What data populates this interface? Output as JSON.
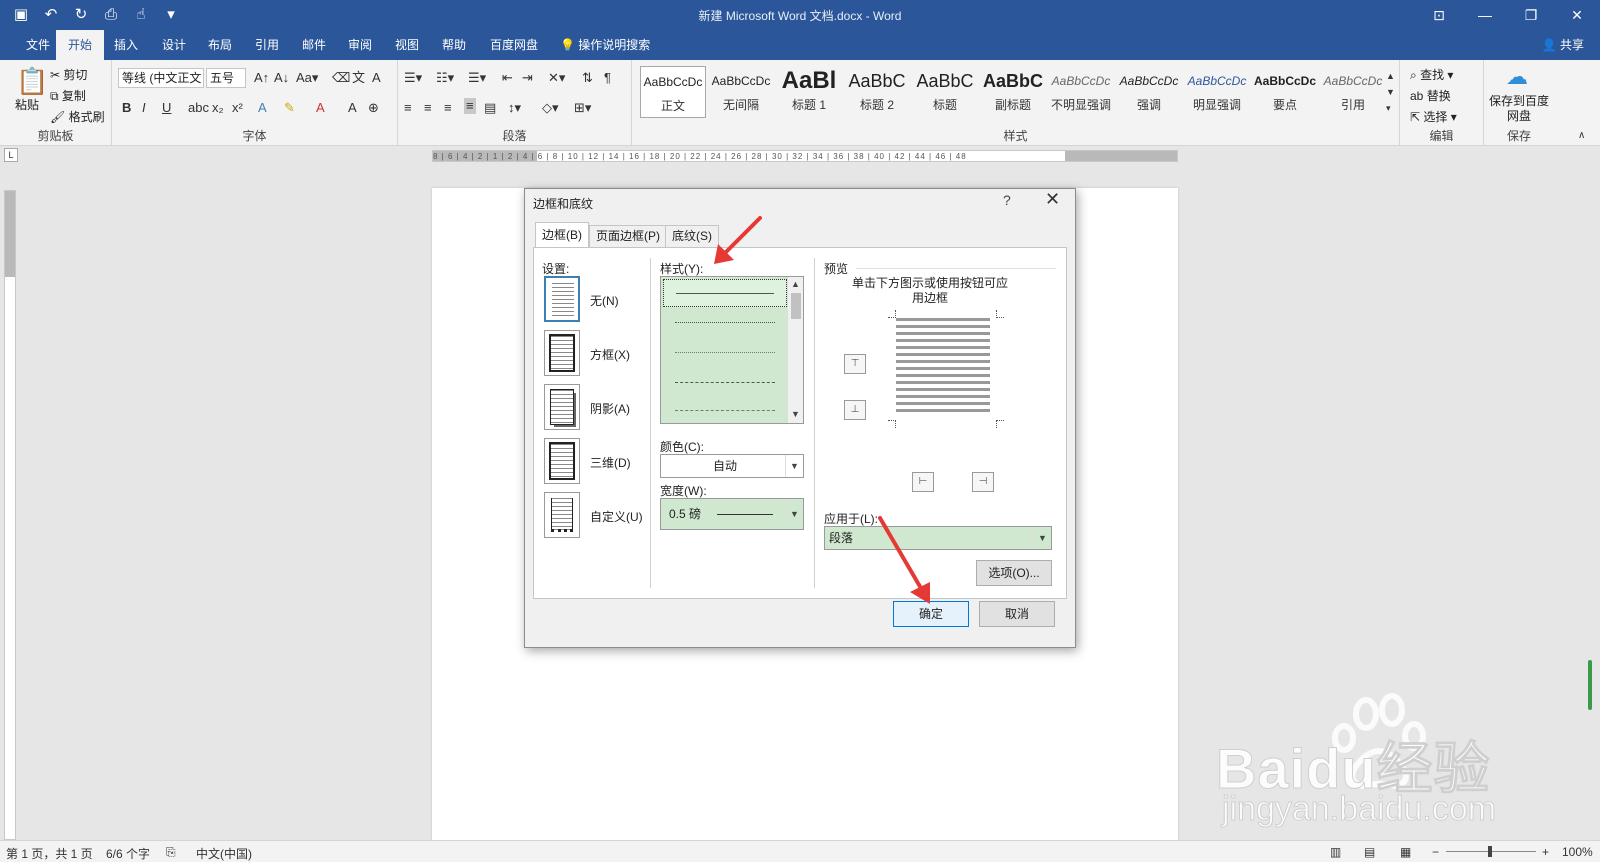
{
  "titlebar": {
    "title": "新建 Microsoft Word 文档.docx  -  Word",
    "qat_icons": [
      "save-icon",
      "undo-icon",
      "redo-icon",
      "print-preview-icon",
      "touch-mode-icon",
      "customize-qat-icon"
    ]
  },
  "ribbon_tabs": [
    "文件",
    "开始",
    "插入",
    "设计",
    "布局",
    "引用",
    "邮件",
    "审阅",
    "视图",
    "帮助",
    "百度网盘"
  ],
  "active_tab": "开始",
  "tell_me": "操作说明搜索",
  "share": "共享",
  "clipboard": {
    "paste": "粘贴",
    "cut": "剪切",
    "copy": "复制",
    "format_painter": "格式刷",
    "label": "剪贴板"
  },
  "font": {
    "name": "等线 (中文正文",
    "size": "五号",
    "label": "字体"
  },
  "paragraph": {
    "label": "段落"
  },
  "styles": {
    "label": "样式",
    "items": [
      {
        "preview": "AaBbCcDc",
        "name": "正文"
      },
      {
        "preview": "AaBbCcDc",
        "name": "无间隔"
      },
      {
        "preview": "AaBl",
        "name": "标题 1"
      },
      {
        "preview": "AaBbC",
        "name": "标题 2"
      },
      {
        "preview": "AaBbC",
        "name": "标题"
      },
      {
        "preview": "AaBbC",
        "name": "副标题"
      },
      {
        "preview": "AaBbCcDc",
        "name": "不明显强调"
      },
      {
        "preview": "AaBbCcDc",
        "name": "强调"
      },
      {
        "preview": "AaBbCcDc",
        "name": "明显强调"
      },
      {
        "preview": "AaBbCcDc",
        "name": "要点"
      },
      {
        "preview": "AaBbCcDc",
        "name": "引用"
      }
    ]
  },
  "editing": {
    "find": "查找",
    "replace": "替换",
    "select": "选择",
    "label": "编辑"
  },
  "save_group": {
    "button": "保存到百度网盘",
    "label": "保存"
  },
  "ruler": {
    "text": "8 | 6 | 4 | 2 | 1 | 2 | 4 | 6 | 8 | 10 | 12 | 14 | 16 | 18 | 20 | 22 | 24 | 26 | 28 | 30 | 32 | 34 | 36 | 38 | 40 | 42 | 44 | 46 | 48"
  },
  "dialog": {
    "title": "边框和底纹",
    "help": "?",
    "tabs": [
      "边框(B)",
      "页面边框(P)",
      "底纹(S)"
    ],
    "settings_label": "设置:",
    "settings": [
      "无(N)",
      "方框(X)",
      "阴影(A)",
      "三维(D)",
      "自定义(U)"
    ],
    "style_label": "样式(Y):",
    "color_label": "颜色(C):",
    "color_value": "自动",
    "width_label": "宽度(W):",
    "width_value": "0.5 磅",
    "preview_label": "预览",
    "preview_hint": "单击下方图示或使用按钮可应用边框",
    "apply_label": "应用于(L):",
    "apply_value": "段落",
    "options_button": "选项(O)...",
    "ok_button": "确定",
    "cancel_button": "取消"
  },
  "status": {
    "page": "第 1 页，共 1 页",
    "words": "6/6 个字",
    "language": "中文(中国)",
    "zoom": "100%"
  },
  "watermark": {
    "brand": "Baidu经验",
    "url": "jingyan.baidu.com"
  },
  "colors": {
    "word_blue": "#2b579a",
    "selection_green": "#cfe8cf",
    "arrow_red": "#e53935",
    "primary_border": "#0078d7"
  }
}
